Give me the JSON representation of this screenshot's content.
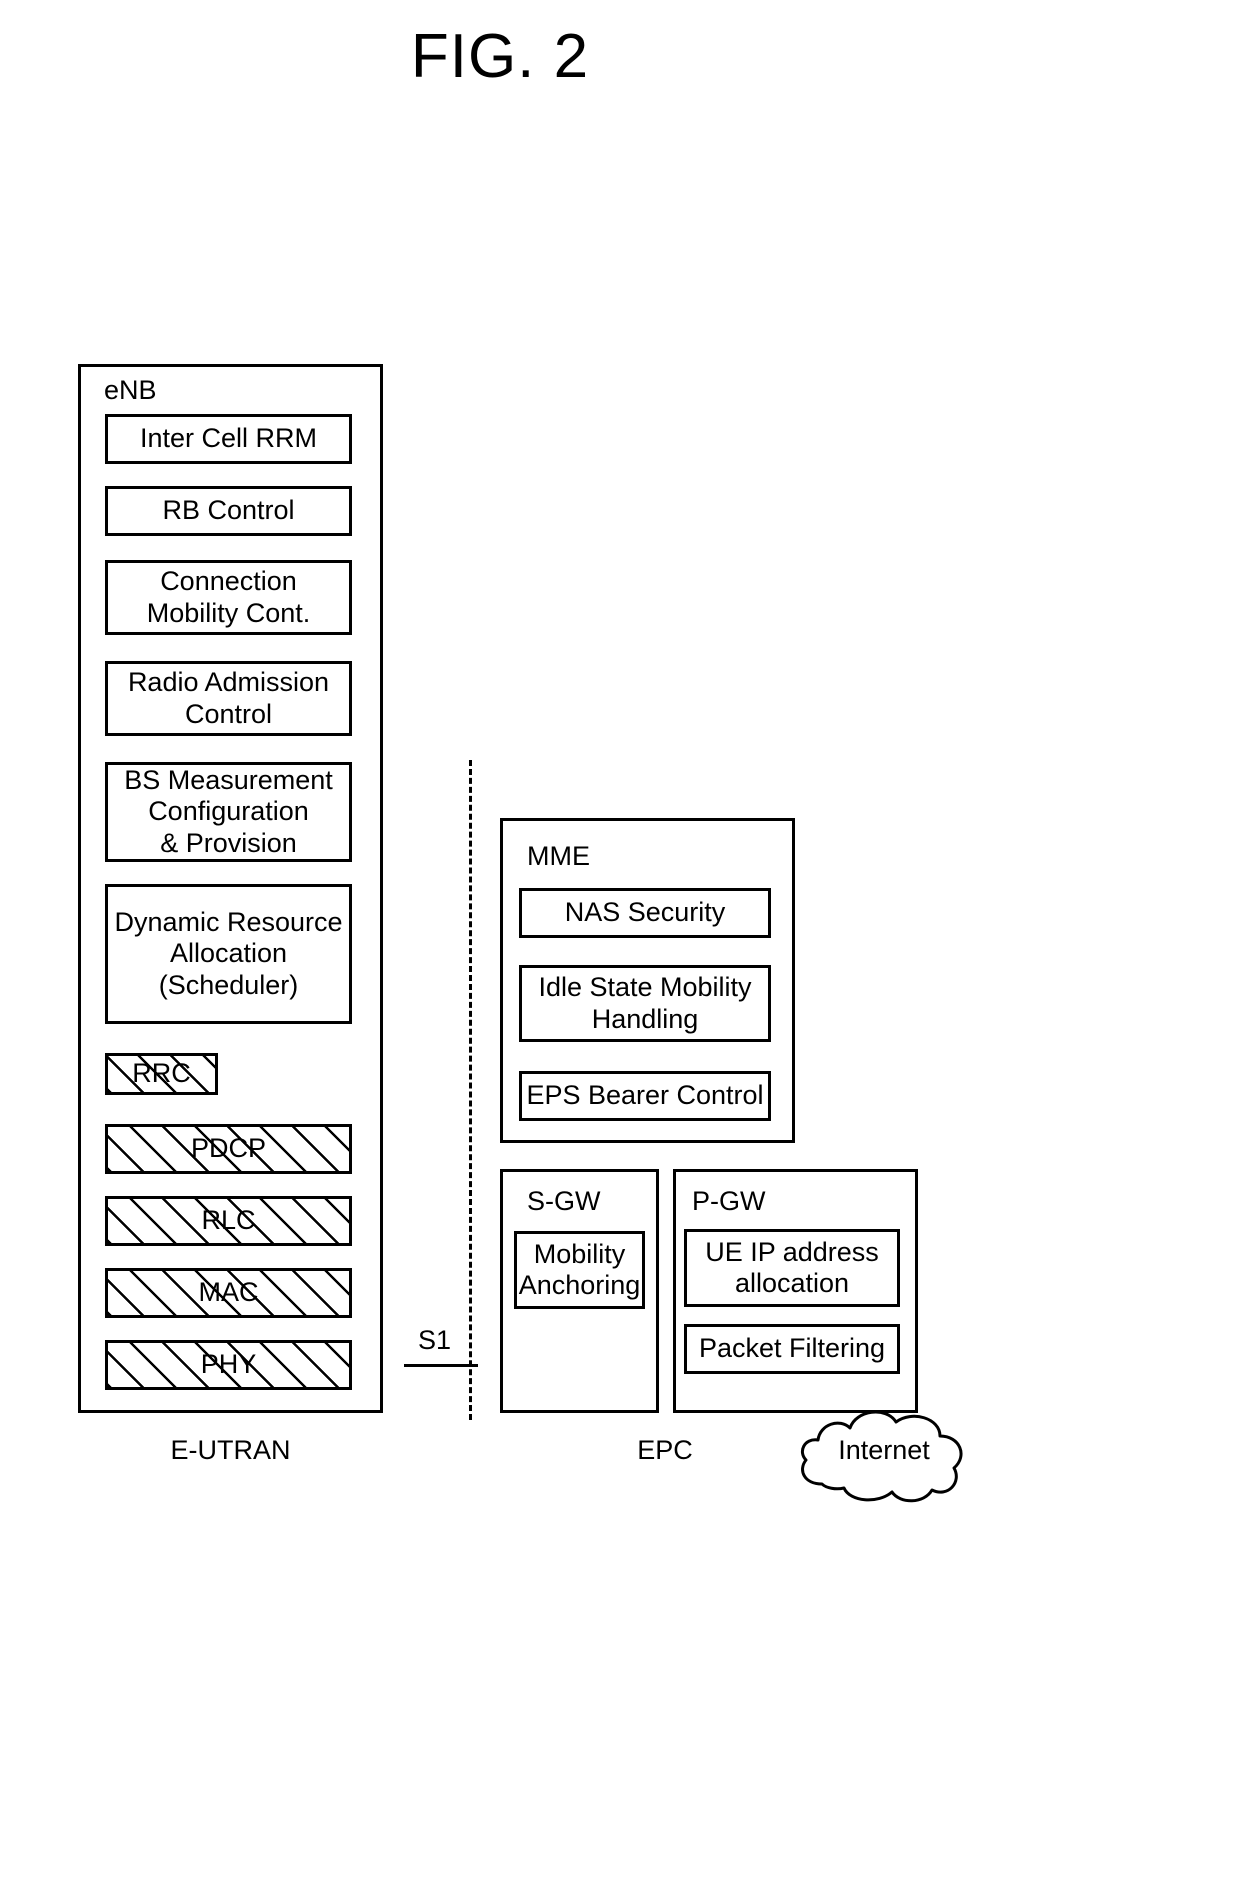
{
  "figure": {
    "title": "FIG. 2"
  },
  "enutran": {
    "caption": "E-UTRAN",
    "enb": {
      "title": "eNB",
      "functions": [
        {
          "label": "Inter Cell RRM"
        },
        {
          "label": "RB Control"
        },
        {
          "label": "Connection\nMobility Cont."
        },
        {
          "label": "Radio Admission\nControl"
        },
        {
          "label": "BS Measurement\nConfiguration\n& Provision"
        },
        {
          "label": "Dynamic Resource\nAllocation\n(Scheduler)"
        }
      ],
      "protocol_layers": [
        {
          "label": "RRC"
        },
        {
          "label": "PDCP"
        },
        {
          "label": "RLC"
        },
        {
          "label": "MAC"
        },
        {
          "label": "PHY"
        }
      ]
    }
  },
  "interface": {
    "s1_label": "S1"
  },
  "epc": {
    "caption": "EPC",
    "mme": {
      "title": "MME",
      "functions": [
        {
          "label": "NAS Security"
        },
        {
          "label": "Idle State Mobility\nHandling"
        },
        {
          "label": "EPS Bearer Control"
        }
      ]
    },
    "sgw": {
      "title": "S-GW",
      "functions": [
        {
          "label": "Mobility\nAnchoring"
        }
      ]
    },
    "pgw": {
      "title": "P-GW",
      "functions": [
        {
          "label": "UE IP address\nallocation"
        },
        {
          "label": "Packet Filtering"
        }
      ]
    }
  },
  "internet": {
    "label": "Internet"
  },
  "colors": {
    "line": "#000000",
    "background": "#ffffff"
  }
}
